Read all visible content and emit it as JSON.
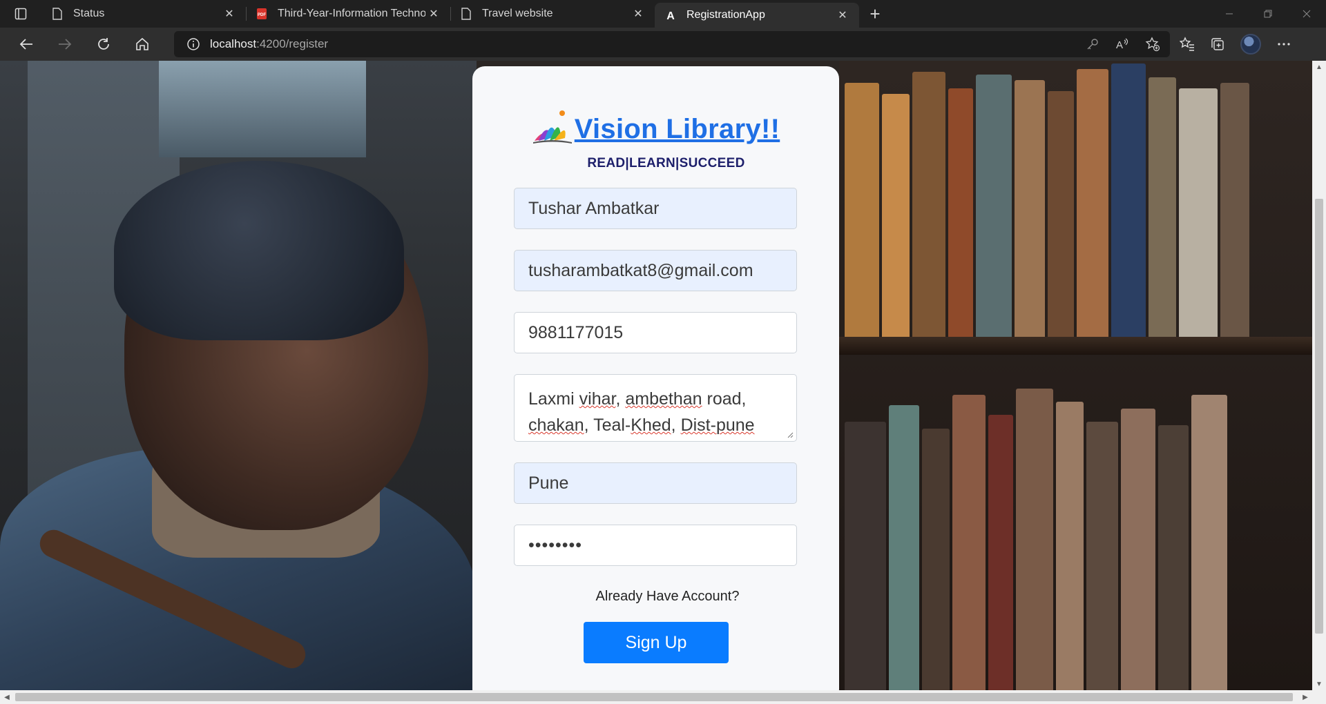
{
  "browser": {
    "tabs": [
      {
        "title": "Status",
        "icon": "page-icon"
      },
      {
        "title": "Third-Year-Information Technolo",
        "icon": "pdf-icon"
      },
      {
        "title": "Travel website",
        "icon": "page-icon"
      },
      {
        "title": "RegistrationApp",
        "icon": "angular-icon"
      }
    ],
    "active_tab_index": 3,
    "address": {
      "host": "localhost",
      "path": ":4200/register"
    }
  },
  "brand": {
    "title": "Vision Library!!",
    "tagline": "READ|LEARN|SUCCEED"
  },
  "form": {
    "name": "Tushar Ambatkar",
    "email": "tusharambatkat8@gmail.com",
    "phone": "9881177015",
    "address_parts": [
      "Laxmi ",
      "vihar",
      ", ",
      "ambethan",
      " road,",
      "chakan",
      ", Teal-",
      "Khed",
      ", ",
      "Dist-pune"
    ],
    "city": "Pune",
    "password_mask": "••••••••",
    "already_text": "Already Have Account?",
    "signup_label": "Sign Up"
  },
  "colors": {
    "brand_blue": "#1f6fe5",
    "tagline_navy": "#1d1f6b",
    "button_blue": "#0a7cff",
    "autofill_bg": "#e8f0fe"
  }
}
